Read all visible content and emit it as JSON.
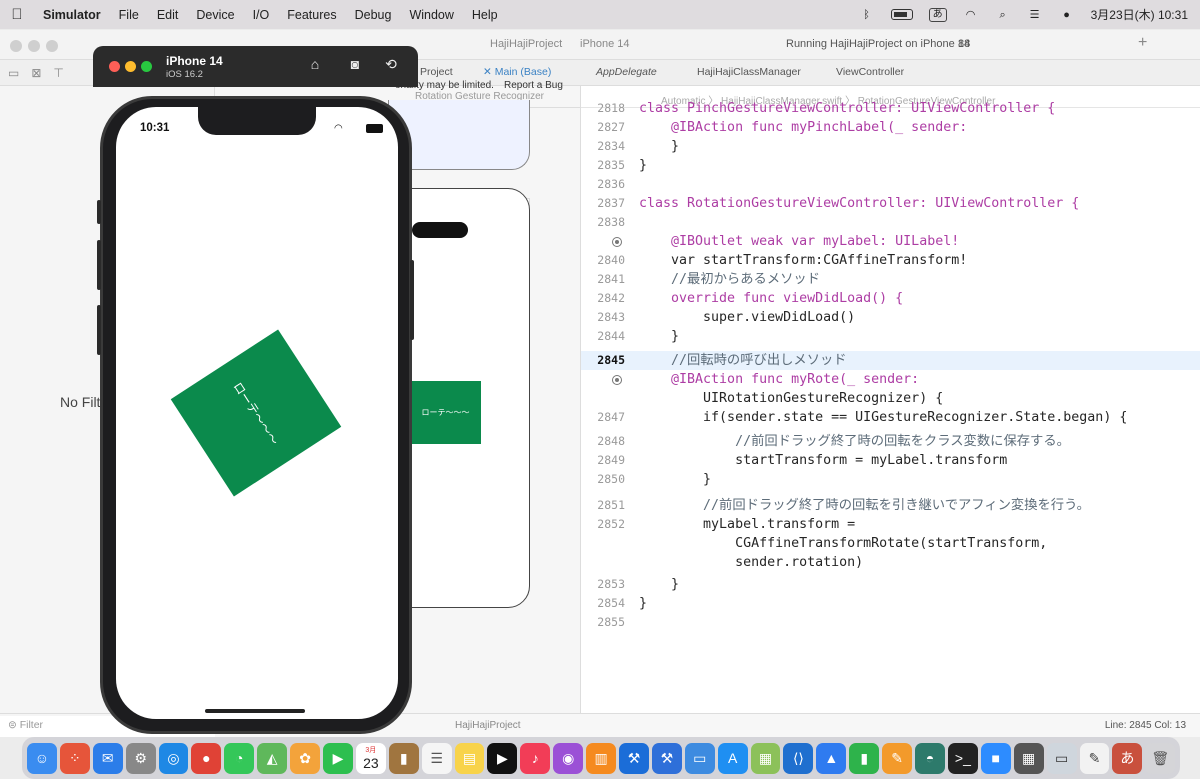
{
  "menubar": {
    "apple": "",
    "app": "Simulator",
    "items": [
      "File",
      "Edit",
      "Device",
      "I/O",
      "Features",
      "Debug",
      "Window",
      "Help"
    ],
    "ime": "あ",
    "clock": "3月23日(木) 10:31"
  },
  "toolbar": {
    "project": "HajiHajiProject",
    "scheme": "HajiHajiProject",
    "device": "iPhone 14",
    "status": "Running HajiHajiProject on iPhone 14",
    "warnings": "88"
  },
  "tabs": [
    "Project",
    "Main (Base)",
    "AppDelegate",
    "HajiHajiClassManager",
    "ViewController"
  ],
  "left_nav": {
    "no_filter": "No Filte",
    "filter_placeholder": "Filter"
  },
  "ib": {
    "breadcrumb": "Rotation Gesture Recognizer",
    "limited": "onality may be limited.",
    "report": "Report a Bug",
    "bg_label": "ローテ〜〜〜"
  },
  "jumpbar": {
    "mode": "Automatic",
    "file": "HajiHajiClassManager.swift",
    "symbol": "RotationGestureViewController"
  },
  "code_lines": [
    {
      "n": "2818",
      "t": "class PinchGestureViewController: UIViewController {"
    },
    {
      "n": "2827",
      "t": "    @IBAction func myPinchLabel(_ sender:"
    },
    {
      "n": "2834",
      "t": "    }"
    },
    {
      "n": "2835",
      "t": "}"
    },
    {
      "n": "2836",
      "t": ""
    },
    {
      "n": "2837",
      "t": "class RotationGestureViewController: UIViewController {"
    },
    {
      "n": "2838",
      "t": ""
    },
    {
      "n": "",
      "t": "    @IBOutlet weak var myLabel: UILabel!"
    },
    {
      "n": "2840",
      "t": "    var startTransform:CGAffineTransform!"
    },
    {
      "n": "2841",
      "t": "    //最初からあるメソッド"
    },
    {
      "n": "2842",
      "t": "    override func viewDidLoad() {"
    },
    {
      "n": "2843",
      "t": "        super.viewDidLoad()"
    },
    {
      "n": "2844",
      "t": "    }"
    },
    {
      "n": "2845",
      "t": "    //回転時の呼び出しメソッド"
    },
    {
      "n": "",
      "t": "    @IBAction func myRote(_ sender:"
    },
    {
      "n": "",
      "t": "        UIRotationGestureRecognizer) {"
    },
    {
      "n": "2847",
      "t": "        if(sender.state == UIGestureRecognizer.State.began) {"
    },
    {
      "n": "2848",
      "t": "            //前回ドラッグ終了時の回転をクラス変数に保存する。"
    },
    {
      "n": "2849",
      "t": "            startTransform = myLabel.transform"
    },
    {
      "n": "2850",
      "t": "        }"
    },
    {
      "n": "2851",
      "t": "        //前回ドラッグ終了時の回転を引き継いでアフィン変換を行う。"
    },
    {
      "n": "2852",
      "t": "        myLabel.transform ="
    },
    {
      "n": "",
      "t": "            CGAffineTransformRotate(startTransform,"
    },
    {
      "n": "",
      "t": "            sender.rotation)"
    },
    {
      "n": "2853",
      "t": "    }"
    },
    {
      "n": "2854",
      "t": "}"
    },
    {
      "n": "2855",
      "t": ""
    }
  ],
  "status": {
    "crumb": "HajiHajiProject",
    "position": "Line: 2845  Col: 13"
  },
  "simulator": {
    "device_name": "iPhone 14",
    "os": "iOS 16.2",
    "time": "10:31",
    "label": "ローテ〜〜〜"
  },
  "dock": {
    "calendar_month": "3月",
    "calendar_day": "23",
    "ime": "あ"
  }
}
